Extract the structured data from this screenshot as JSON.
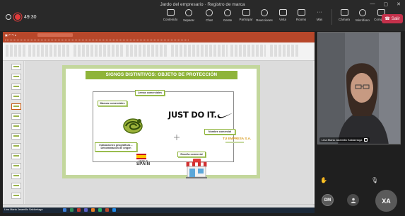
{
  "meeting": {
    "title": "Jardo del empresario · Registro de marca",
    "timer": "49:30",
    "toolbar": [
      {
        "label": "Contenido",
        "icon": "share-screen-icon"
      },
      {
        "label": "Separar",
        "icon": "popout-icon"
      },
      {
        "label": "Chat",
        "icon": "chat-icon"
      },
      {
        "label": "Gente",
        "icon": "people-icon"
      },
      {
        "label": "Participar",
        "icon": "raise-hand-icon"
      },
      {
        "label": "Reacciones",
        "icon": "emoji-icon"
      },
      {
        "label": "Vista",
        "icon": "grid-view-icon"
      },
      {
        "label": "Rooms",
        "icon": "rooms-icon"
      },
      {
        "label": "Más",
        "icon": "more-icon"
      },
      {
        "label": "Cámara",
        "icon": "camera-off-icon"
      },
      {
        "label": "Micrófono",
        "icon": "mic-icon"
      },
      {
        "label": "Compartir",
        "icon": "share-icon"
      }
    ],
    "leave_label": "Salir"
  },
  "presenter": {
    "name_label": "Lina Maria Jaramillo Saldarriaga",
    "screen_share_label": "Lina Maria Jaramillo Saldarriaga"
  },
  "slide": {
    "title": "SIGNOS DISTINTIVOS: OBJETO DE PROTECCIÓN",
    "callouts": {
      "lemas": "Lemas comerciales",
      "marcas": "Marcas comerciales",
      "nombre": "Nombre comercial",
      "indicaciones": "Indicaciones geográficas – Denominación de origen",
      "ensena": "Enseña comercial"
    },
    "nike_slogan": "JUST DO IT.",
    "company_name": "TU EMPRESA S.A.",
    "spain_caption": "MADE IN",
    "spain_big": "SPAIN"
  },
  "participants": {
    "dm": "DM",
    "xa": "XA"
  },
  "colors": {
    "ppt_accent": "#b7472a",
    "slide_green": "#8fb43a",
    "leave_red": "#c4314b"
  }
}
